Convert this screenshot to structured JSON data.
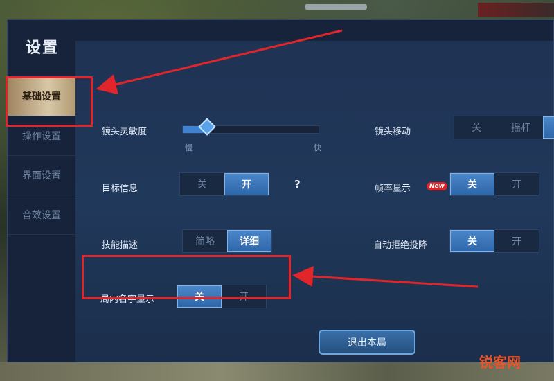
{
  "panel": {
    "title": "设置"
  },
  "sidebar": {
    "items": [
      {
        "label": "基础设置",
        "active": true
      },
      {
        "label": "操作设置",
        "active": false
      },
      {
        "label": "界面设置",
        "active": false
      },
      {
        "label": "音效设置",
        "active": false
      }
    ]
  },
  "settings": {
    "camera_sensitivity": {
      "label": "镜头灵敏度",
      "min_label": "慢",
      "max_label": "快",
      "value_fraction": 0.18
    },
    "camera_move": {
      "label": "镜头移动",
      "options": [
        "关",
        "摇杆"
      ]
    },
    "target_info": {
      "label": "目标信息",
      "options": [
        "关",
        "开"
      ],
      "selected": "开",
      "help": "?"
    },
    "frame_rate": {
      "label": "帧率显示",
      "options": [
        "关",
        "开"
      ],
      "selected": "关"
    },
    "skill_desc": {
      "label": "技能描述",
      "options": [
        "简略",
        "详细"
      ],
      "selected": "详细"
    },
    "auto_reject": {
      "label": "自动拒绝投降",
      "badge": "New",
      "options": [
        "关",
        "开"
      ],
      "selected": "关"
    },
    "in_game_names": {
      "label": "局内名字显示",
      "options": [
        "关",
        "开"
      ],
      "selected": "关"
    }
  },
  "exit_button": {
    "label": "退出本局"
  },
  "watermark": {
    "text": "锐客网"
  },
  "colors": {
    "highlight": "#e0262b",
    "accent": "#3f82d0"
  }
}
